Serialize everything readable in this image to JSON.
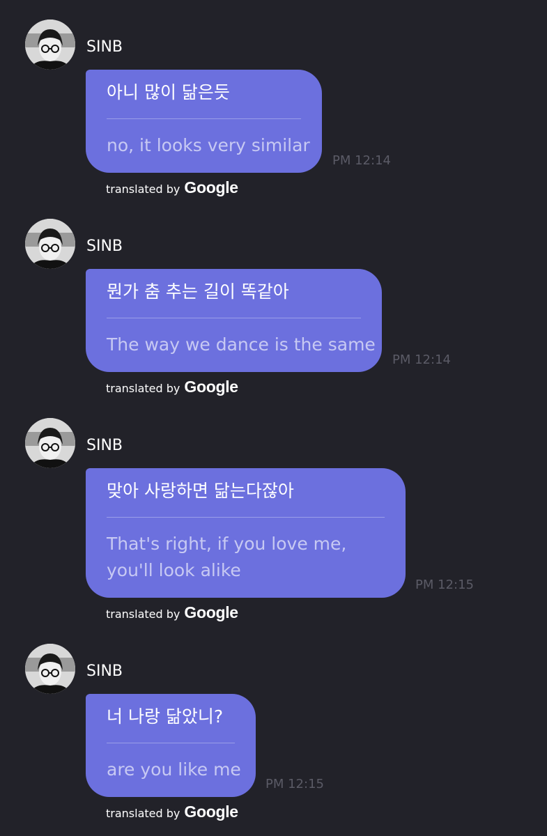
{
  "messages": [
    {
      "sender": "SINB",
      "original": "아니 많이 닮은듯",
      "translation_lines": [
        "no, it looks very similar"
      ],
      "time": "PM 12:14",
      "credit": {
        "prefix": "translated by",
        "brand": "Google"
      },
      "avatar_icon": "profile-photo"
    },
    {
      "sender": "SINB",
      "original": "뭔가 춤 추는 길이 똑같아",
      "translation_lines": [
        "The way we dance is the same"
      ],
      "time": "PM 12:14",
      "credit": {
        "prefix": "translated by",
        "brand": "Google"
      },
      "avatar_icon": "profile-photo"
    },
    {
      "sender": "SINB",
      "original": "맞아 사랑하면 닮는다잖아",
      "translation_lines": [
        "That's right, if you love me,",
        "you'll look alike"
      ],
      "time": "PM 12:15",
      "credit": {
        "prefix": "translated by",
        "brand": "Google"
      },
      "avatar_icon": "profile-photo"
    },
    {
      "sender": "SINB",
      "original": "너 나랑 닮았니?",
      "translation_lines": [
        "are you like me"
      ],
      "time": "PM 12:15",
      "credit": {
        "prefix": "translated by",
        "brand": "Google"
      },
      "avatar_icon": "profile-photo"
    }
  ],
  "colors": {
    "background": "#222229",
    "bubble": "#6c70de",
    "original_text": "#ffffff",
    "translation_text": "#c7c9f3",
    "timestamp": "#5b5b66"
  }
}
